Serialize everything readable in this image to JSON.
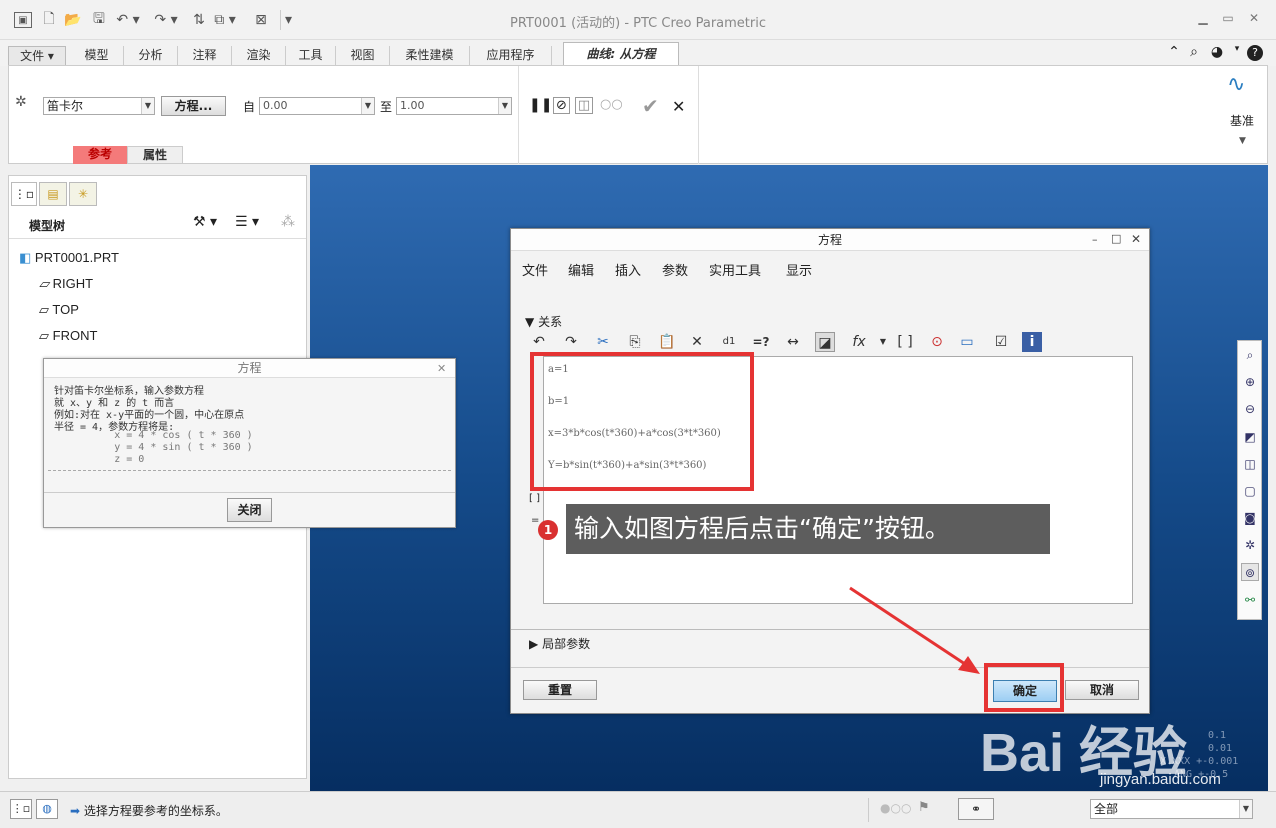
{
  "window": {
    "title": "PRT0001 (活动的) - PTC Creo Parametric"
  },
  "ribbon_tabs": [
    "文件",
    "模型",
    "分析",
    "注释",
    "渲染",
    "工具",
    "视图",
    "柔性建模",
    "应用程序"
  ],
  "active_tab": "曲线: 从方程",
  "ribbon": {
    "coord_type": "笛卡尔",
    "equation_button": "方程...",
    "from_label": "自",
    "from_value": "0.00",
    "to_label": "至",
    "to_value": "1.00",
    "datum_label": "基准",
    "subtabs": [
      "参考",
      "属性"
    ]
  },
  "model_tree": {
    "title": "模型树",
    "root": "PRT0001.PRT",
    "items": [
      "RIGHT",
      "TOP",
      "FRONT"
    ]
  },
  "popup": {
    "title": "方程",
    "lines": [
      "针对笛卡尔坐标系，输入参数方程",
      "就 x、y 和 z 的 t 而言",
      "例如:对在 x-y平面的一个圆，中心在原点",
      "半径 = 4，参数方程将是:",
      "          x = 4 * cos ( t * 360 )",
      "          y = 4 * sin ( t * 360 )",
      "          z = 0"
    ],
    "close_button": "关闭"
  },
  "dialog": {
    "title": "方程",
    "menu": [
      "文件",
      "编辑",
      "插入",
      "参数",
      "实用工具",
      "显示"
    ],
    "section_relations": "关系",
    "section_local_params": "局部参数",
    "equations": [
      "a=1",
      "b=1",
      "x=3*b*cos(t*360)+a*cos(3*t*360)",
      "Y=b*sin(t*360)+a*sin(3*t*360)"
    ],
    "reset_button": "重置",
    "ok_button": "确定",
    "cancel_button": "取消"
  },
  "annotation": {
    "step": "1",
    "text": "输入如图方程后点击“确定”按钮。"
  },
  "status_bar": {
    "message": "选择方程要参考的坐标系。",
    "filter": "全部"
  },
  "viewport_overlay": [
    "0.1",
    "0.01",
    "X.XXX +-0.001",
    "ANG +-0.5"
  ],
  "watermark": {
    "brand": "Bai 经验",
    "url": "jingyan.baidu.com"
  },
  "colors": {
    "viewport_top": "#2f6bb2",
    "viewport_bottom": "#062e61",
    "highlight_red": "#e53333",
    "active_subtab": "#f47a7a"
  }
}
